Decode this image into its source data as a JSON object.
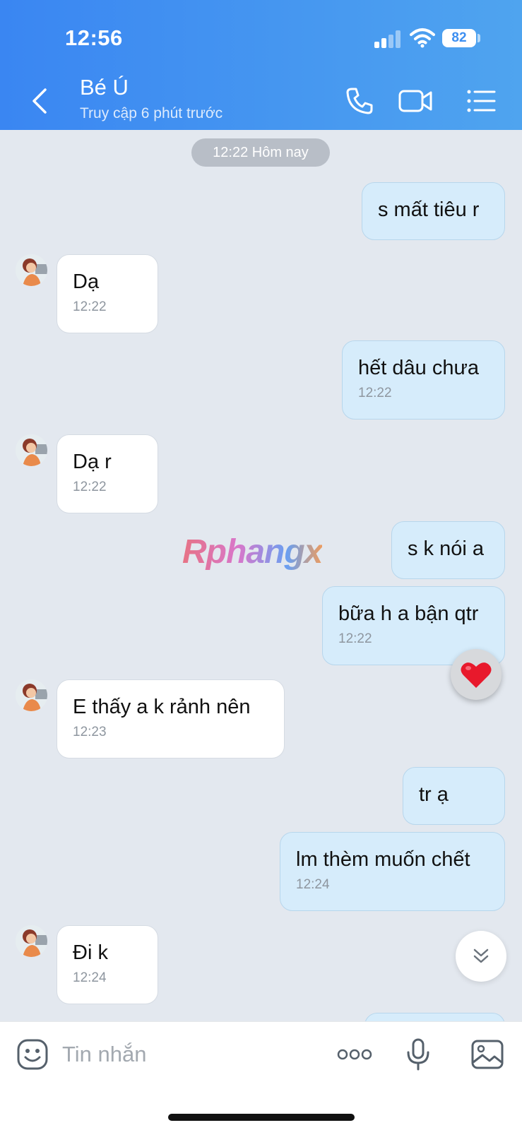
{
  "status_bar": {
    "time": "12:56",
    "battery": "82"
  },
  "header": {
    "name": "Bé Ú",
    "status": "Truy cập 6 phút trước",
    "icons": [
      "back-icon",
      "phone-icon",
      "video-call-icon",
      "menu-list-icon"
    ]
  },
  "chat": {
    "date_divider": "12:22 Hôm nay",
    "messages": [
      {
        "dir": "out",
        "text": "s mất tiêu r",
        "time": ""
      },
      {
        "dir": "in",
        "text": "Dạ",
        "time": "12:22"
      },
      {
        "dir": "out",
        "text": "hết dâu chưa",
        "time": "12:22"
      },
      {
        "dir": "in",
        "text": "Dạ r",
        "time": "12:22"
      },
      {
        "dir": "out",
        "text": "s k nói a",
        "time": ""
      },
      {
        "dir": "out",
        "text": "bữa h a bận qtr",
        "time": "12:22"
      },
      {
        "dir": "in",
        "text": "E thấy a k rảnh nên",
        "time": "12:23"
      },
      {
        "dir": "out",
        "text": "tr ạ",
        "time": ""
      },
      {
        "dir": "out",
        "text": "lm thèm muốn chết",
        "time": "12:24"
      },
      {
        "dir": "in",
        "text": "Đi k",
        "time": "12:24"
      }
    ],
    "watermark": "Rphangx",
    "reaction_icon": "heart-icon"
  },
  "input": {
    "placeholder": "Tin nhắn",
    "icons": [
      "emoji-icon",
      "more-icon",
      "microphone-icon",
      "image-icon"
    ]
  },
  "colors": {
    "header_start": "#3a86f2",
    "header_end": "#4fa4ef",
    "outgoing_bubble": "#d6ecfb",
    "incoming_bubble": "#ffffff",
    "chat_background": "#e3e8ef"
  }
}
